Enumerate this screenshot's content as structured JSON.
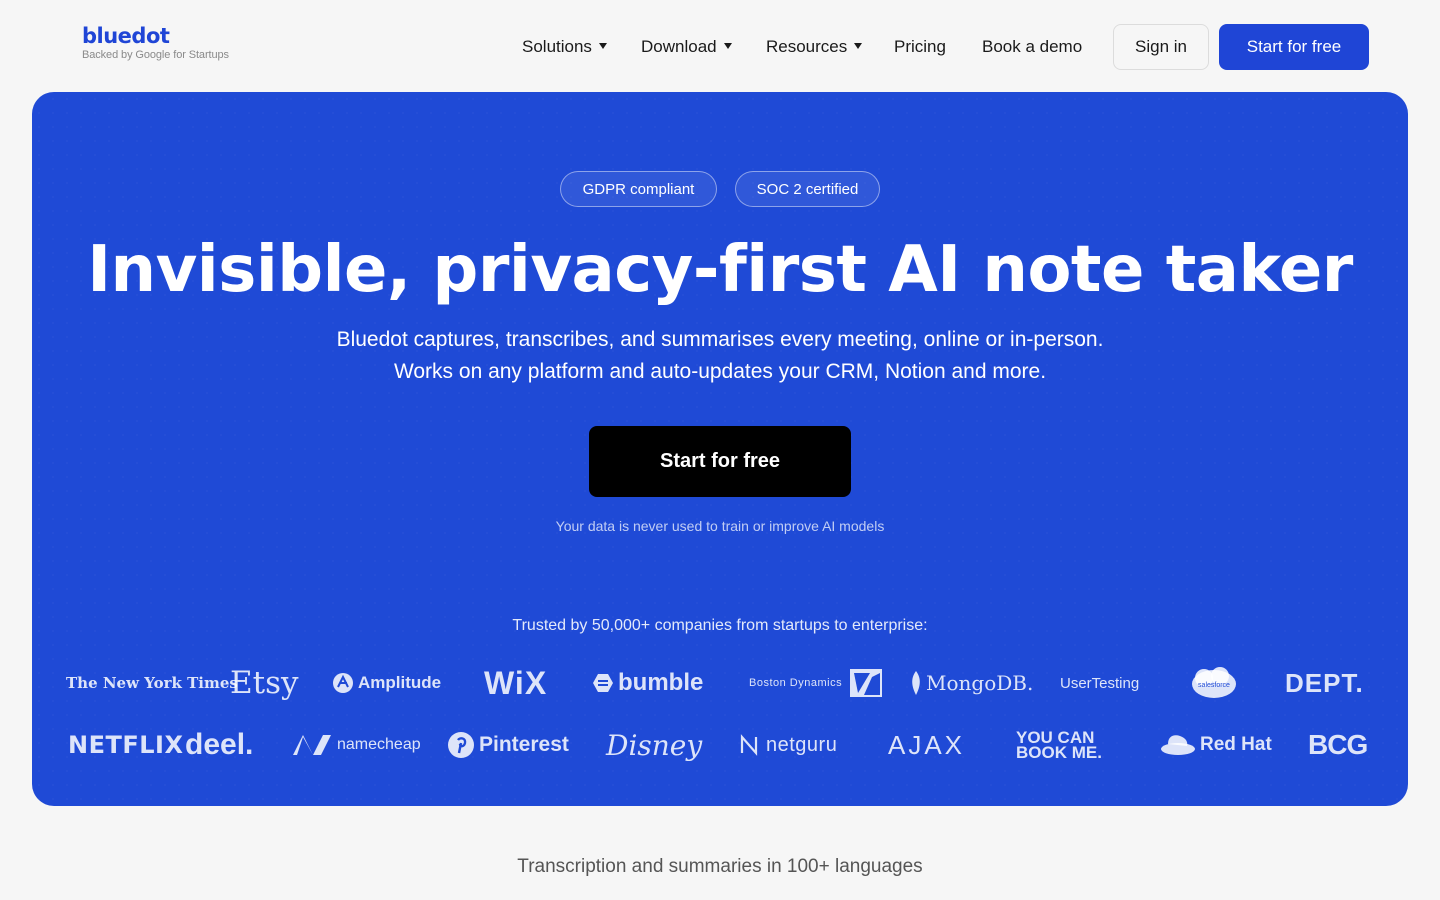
{
  "header": {
    "logo": {
      "name": "bluedot",
      "tagline": "Backed by Google for Startups"
    },
    "nav": [
      {
        "label": "Solutions",
        "dropdown": true
      },
      {
        "label": "Download",
        "dropdown": true
      },
      {
        "label": "Resources",
        "dropdown": true
      },
      {
        "label": "Pricing",
        "dropdown": false
      },
      {
        "label": "Book a demo",
        "dropdown": false
      }
    ],
    "sign_in": "Sign in",
    "start_free": "Start for free"
  },
  "hero": {
    "badges": [
      "GDPR compliant",
      "SOC 2 certified"
    ],
    "title": "Invisible, privacy-first AI note taker",
    "subtitle_line1": "Bluedot captures, transcribes, and summarises every meeting, online or in-person.",
    "subtitle_line2": "Works on any platform and auto-updates your CRM, Notion and more.",
    "cta": "Start for free",
    "note": "Your data is never used to train or improve AI models",
    "trusted": "Trusted by 50,000+ companies from startups to enterprise:",
    "logos_row1": [
      "The New York Times",
      "Etsy",
      "Amplitude",
      "WiX",
      "bumble",
      "Boston Dynamics",
      "MongoDB.",
      "UserTesting",
      "salesforce",
      "DEPT."
    ],
    "logos_row2": [
      "NETFLIX",
      "deel.",
      "namecheap",
      "Pinterest",
      "Disney",
      "netguru",
      "AJAX",
      "YOU CAN BOOK ME.",
      "Red Hat",
      "BCG"
    ]
  },
  "bottom": {
    "languages": "Transcription and summaries in 100+ languages"
  },
  "colors": {
    "brand_blue": "#1f45d6",
    "hero_blue": "#1f4ad6",
    "background": "#f6f6f6",
    "cta_black": "#000000"
  }
}
